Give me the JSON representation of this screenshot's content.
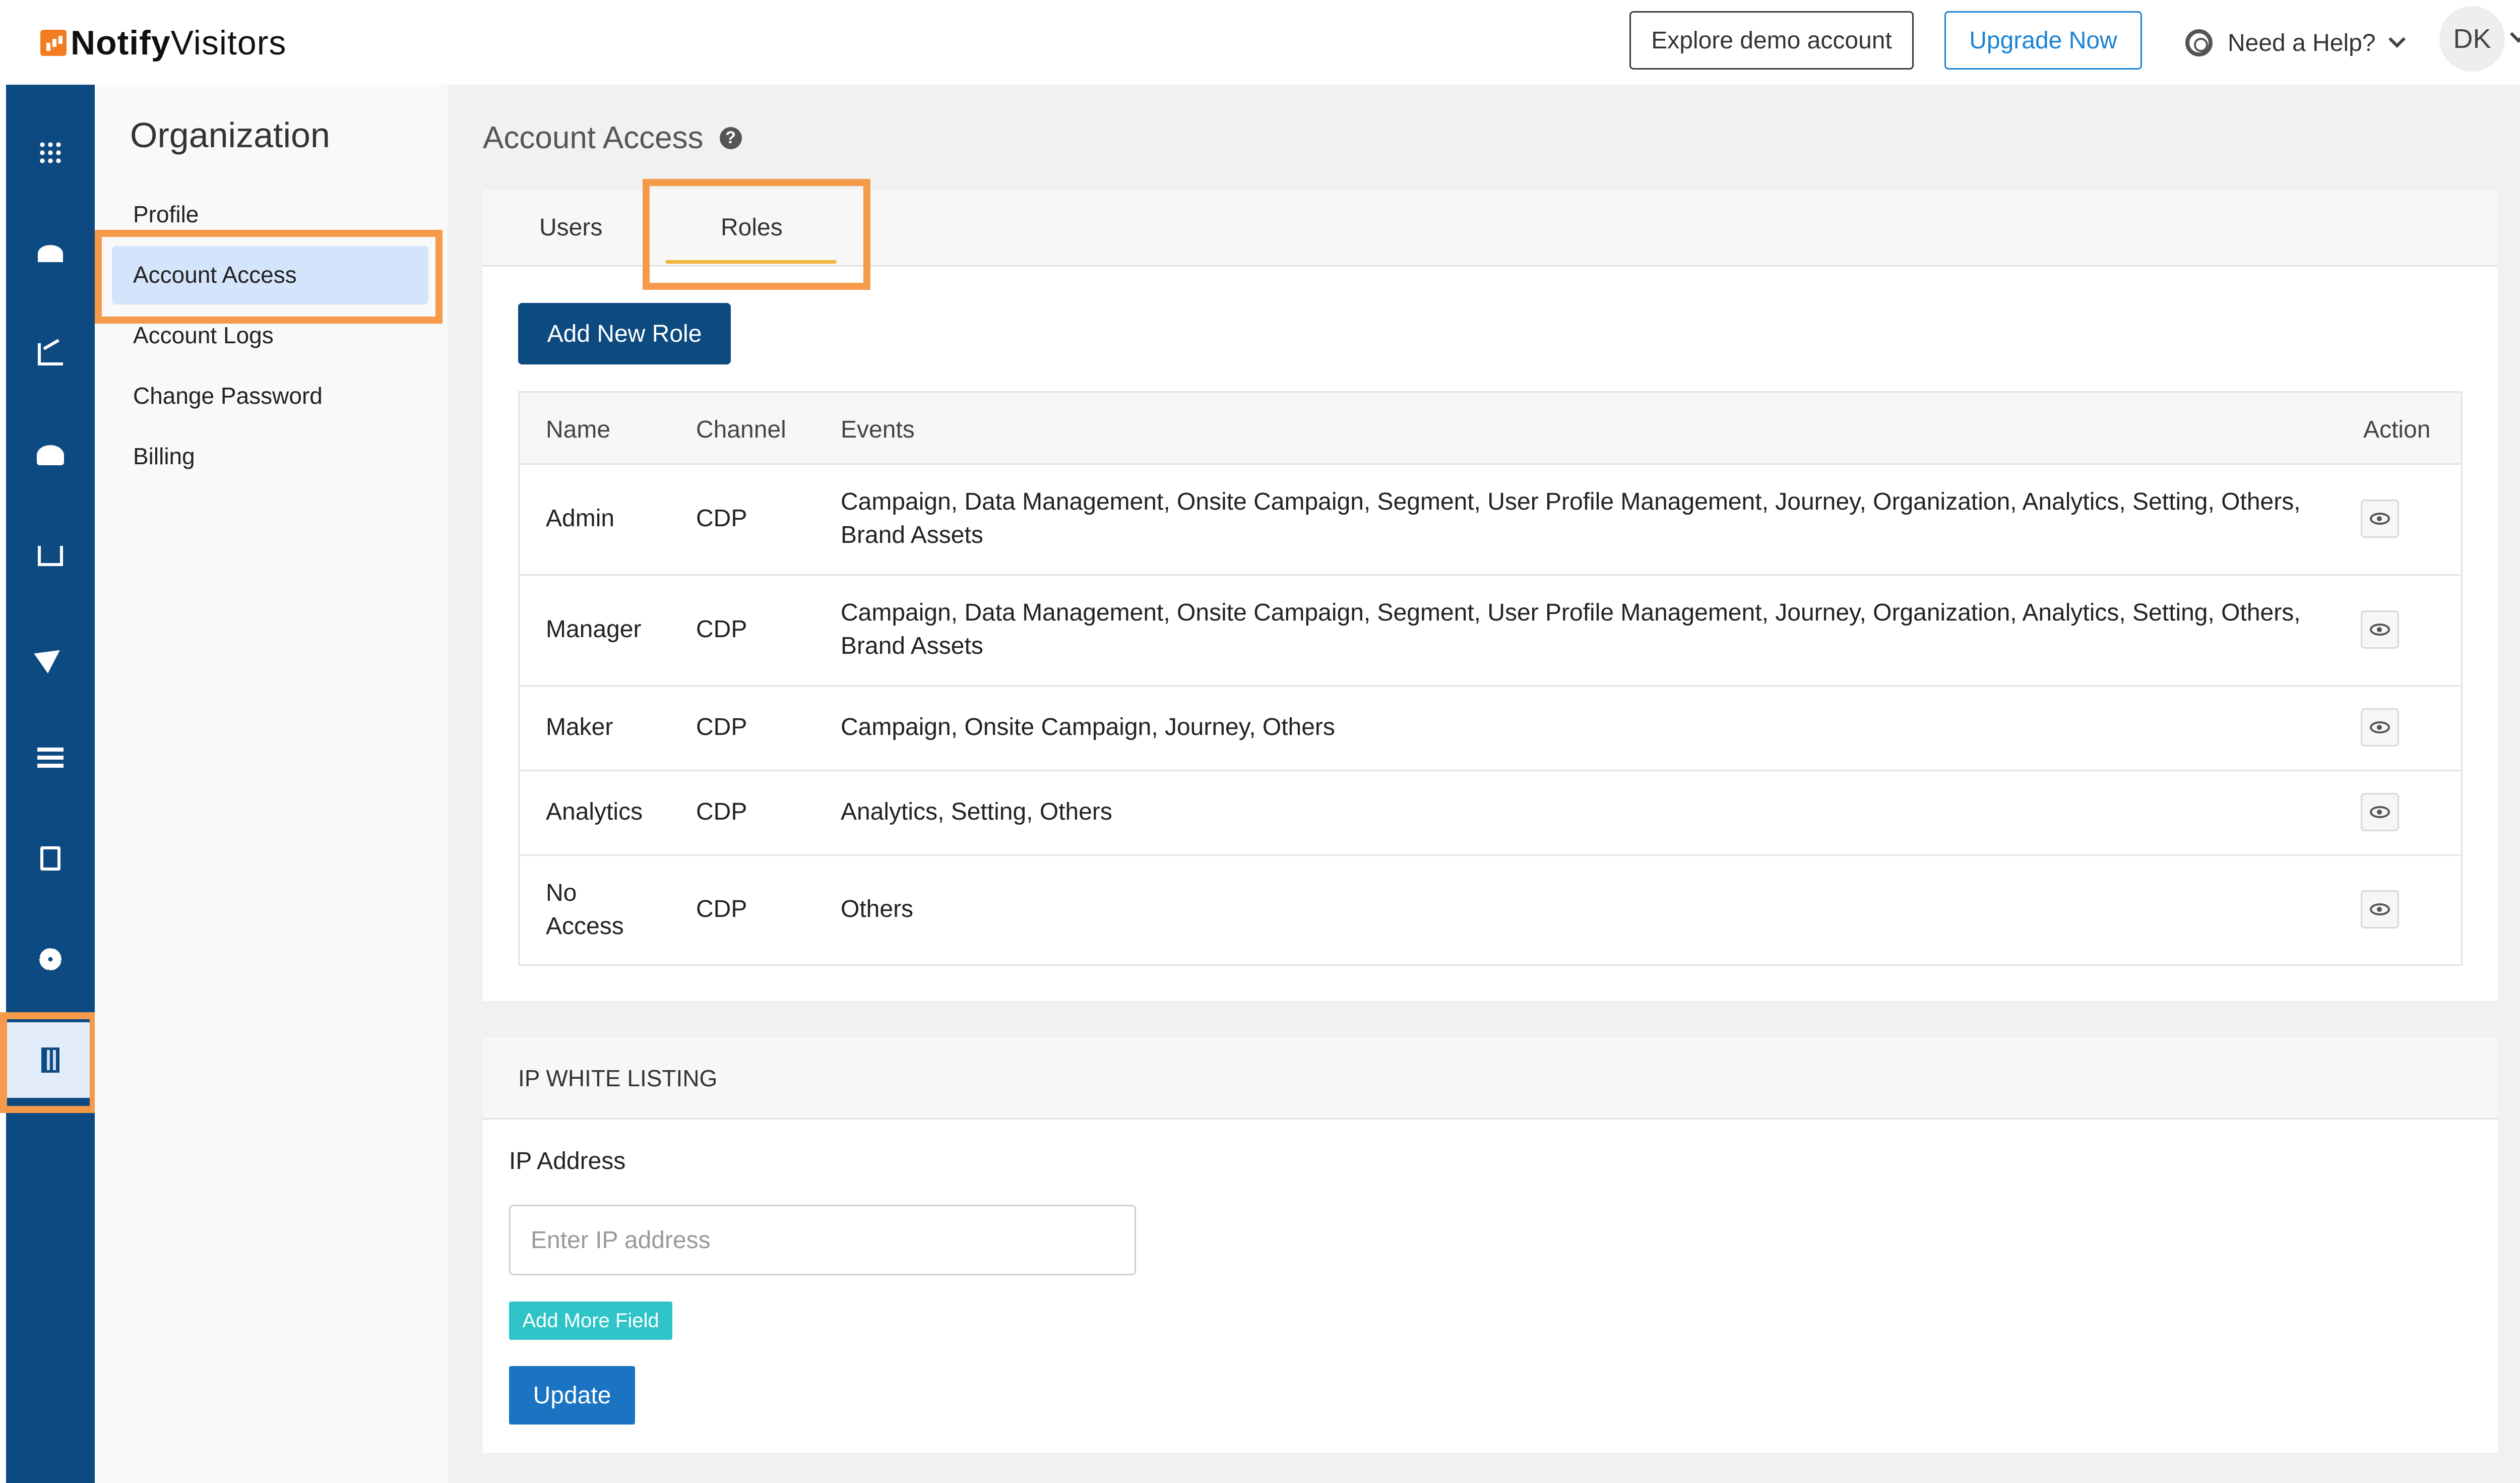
{
  "header": {
    "brand_bold": "Notify",
    "brand_rest": "Visitors",
    "explore_label": "Explore demo account",
    "upgrade_label": "Upgrade Now",
    "help_label": "Need a Help?",
    "avatar_initials": "DK"
  },
  "rail": {
    "icons": [
      "apps-grid-icon",
      "dashboard-gauge-icon",
      "analytics-chart-icon",
      "users-icon",
      "hierarchy-icon",
      "send-icon",
      "list-icon",
      "image-file-icon",
      "settings-gear-icon",
      "organization-building-icon"
    ],
    "active": "organization-building-icon"
  },
  "org_sidebar": {
    "title": "Organization",
    "items": [
      {
        "label": "Profile"
      },
      {
        "label": "Account Access"
      },
      {
        "label": "Account Logs"
      },
      {
        "label": "Change Password"
      },
      {
        "label": "Billing"
      }
    ],
    "active": "Account Access"
  },
  "main": {
    "title": "Account Access",
    "tabs": [
      {
        "label": "Users"
      },
      {
        "label": "Roles"
      }
    ],
    "active_tab": "Roles",
    "add_role_label": "Add New Role",
    "roles_table": {
      "headers": {
        "name": "Name",
        "channel": "Channel",
        "events": "Events",
        "action": "Action"
      },
      "rows": [
        {
          "name": "Admin",
          "channel": "CDP",
          "events": "Campaign, Data Management, Onsite Campaign, Segment, User Profile Management, Journey, Organization, Analytics, Setting, Others, Brand Assets"
        },
        {
          "name": "Manager",
          "channel": "CDP",
          "events": "Campaign, Data Management, Onsite Campaign, Segment, User Profile Management, Journey, Organization, Analytics, Setting, Others, Brand Assets"
        },
        {
          "name": "Maker",
          "channel": "CDP",
          "events": "Campaign, Onsite Campaign, Journey, Others"
        },
        {
          "name": "Analytics",
          "channel": "CDP",
          "events": "Analytics, Setting, Others"
        },
        {
          "name": "No Access",
          "channel": "CDP",
          "events": "Others"
        }
      ]
    },
    "ip_whitelisting": {
      "title": "IP WHITE LISTING",
      "ip_label": "IP Address",
      "ip_placeholder": "Enter IP address",
      "add_more_label": "Add More Field",
      "update_label": "Update"
    }
  },
  "colors": {
    "rail_bg": "#0e4a82",
    "highlight": "#f49a4a",
    "primary_button": "#0d4a80",
    "upgrade_accent": "#1a83d4",
    "tab_underline": "#f0b53a",
    "add_more_button": "#2ec4c8",
    "update_button": "#1a74c2"
  }
}
